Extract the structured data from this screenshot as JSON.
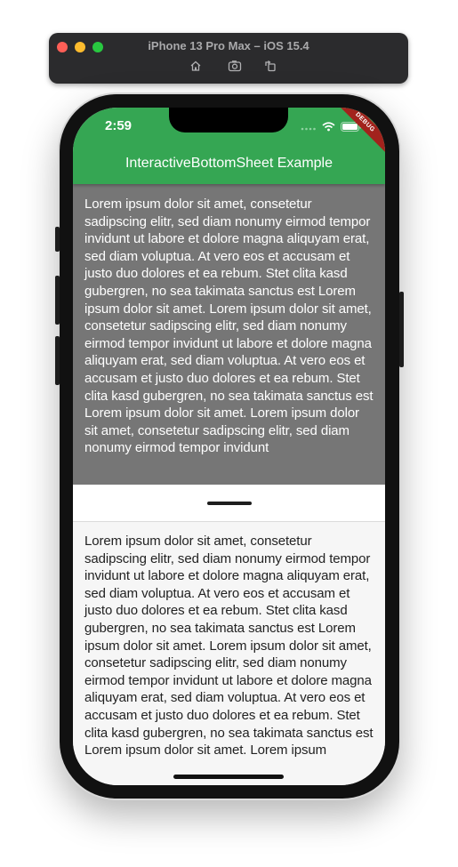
{
  "simulator": {
    "title": "iPhone 13 Pro Max – iOS 15.4",
    "toolbar_icons": [
      "home-icon",
      "screenshot-icon",
      "rotate-icon"
    ]
  },
  "status_bar": {
    "time": "2:59"
  },
  "app_bar": {
    "title": "InteractiveBottomSheet Example",
    "color": "#35a653"
  },
  "debug_banner": "DEBUG",
  "background": {
    "text": "Lorem ipsum dolor sit amet, consetetur sadipscing elitr, sed diam nonumy eirmod tempor invidunt ut labore et dolore magna aliquyam erat, sed diam voluptua. At vero eos et accusam et justo duo dolores et ea rebum. Stet clita kasd gubergren, no sea takimata sanctus est Lorem ipsum dolor sit amet. Lorem ipsum dolor sit amet, consetetur sadipscing elitr, sed diam nonumy eirmod tempor invidunt ut labore et dolore magna aliquyam erat, sed diam voluptua. At vero eos et accusam et justo duo dolores et ea rebum. Stet clita kasd gubergren, no sea takimata sanctus est Lorem ipsum dolor sit amet. Lorem ipsum dolor sit amet, consetetur sadipscing elitr, sed diam nonumy eirmod tempor invidunt"
  },
  "bottom_sheet": {
    "text": "Lorem ipsum dolor sit amet, consetetur sadipscing elitr, sed diam nonumy eirmod tempor invidunt ut labore et dolore magna aliquyam erat, sed diam voluptua. At vero eos et accusam et justo duo dolores et ea rebum. Stet clita kasd gubergren, no sea takimata sanctus est Lorem ipsum dolor sit amet. Lorem ipsum dolor sit amet, consetetur sadipscing elitr, sed diam nonumy eirmod tempor invidunt ut labore et dolore magna aliquyam erat, sed diam voluptua. At vero eos et accusam et justo duo dolores et ea rebum. Stet clita kasd gubergren, no sea takimata sanctus est Lorem ipsum dolor sit amet. Lorem ipsum"
  }
}
